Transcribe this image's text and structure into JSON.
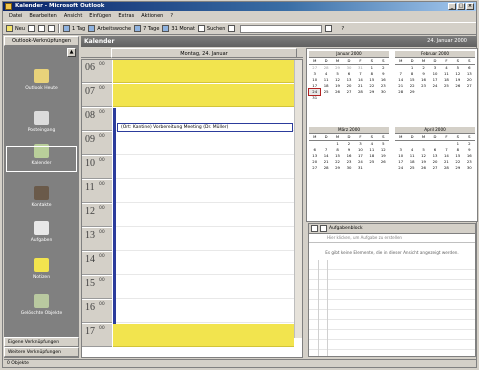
{
  "window": {
    "title": "Kalender - Microsoft Outlook"
  },
  "menu": [
    "Datei",
    "Bearbeiten",
    "Ansicht",
    "Einfügen",
    "Extras",
    "Aktionen",
    "?"
  ],
  "toolbar": {
    "new_label": "Neu",
    "btn1": "1 Tag",
    "btn2": "Arbeitswoche",
    "btn3": "7 Tage",
    "btn4": "31 Monat",
    "btn5": "Suchen",
    "help": "?"
  },
  "sidebar": {
    "header": "Outlook-Verknüpfungen",
    "items": [
      {
        "label": "Outlook Heute"
      },
      {
        "label": "Posteingang"
      },
      {
        "label": "Kalender"
      },
      {
        "label": "Kontakte"
      },
      {
        "label": "Aufgaben"
      },
      {
        "label": "Notizen"
      },
      {
        "label": "Gelöschte Objekte"
      }
    ],
    "group2": "Eigene Verknüpfungen",
    "group3": "Weitere Verknüpfungen"
  },
  "calendar": {
    "folder": "Kalender",
    "date_range": "24. Januar 2000",
    "day_label": "Montag, 24. Januar",
    "hours": [
      {
        "h": "06",
        "m": "00"
      },
      {
        "h": "07",
        "m": "00"
      },
      {
        "h": "08",
        "m": "00"
      },
      {
        "h": "09",
        "m": "00"
      },
      {
        "h": "10",
        "m": "00"
      },
      {
        "h": "11",
        "m": "00"
      },
      {
        "h": "12",
        "m": "00"
      },
      {
        "h": "13",
        "m": "00"
      },
      {
        "h": "14",
        "m": "00"
      },
      {
        "h": "15",
        "m": "00"
      },
      {
        "h": "16",
        "m": "00"
      },
      {
        "h": "17",
        "m": "00"
      }
    ],
    "appointment": "(Ort: Kantine) Vorbereitung Meeting (Dr. Müller)"
  },
  "mini_months": [
    {
      "name": "Januar 2000",
      "weekdays": [
        "M",
        "D",
        "M",
        "D",
        "F",
        "S",
        "S"
      ],
      "days": [
        "27",
        "28",
        "29",
        "30",
        "31",
        "1",
        "2",
        "3",
        "4",
        "5",
        "6",
        "7",
        "8",
        "9",
        "10",
        "11",
        "12",
        "13",
        "14",
        "15",
        "16",
        "17",
        "18",
        "19",
        "20",
        "21",
        "22",
        "23",
        "24",
        "25",
        "26",
        "27",
        "28",
        "29",
        "30",
        "31"
      ]
    },
    {
      "name": "Februar 2000",
      "weekdays": [
        "M",
        "D",
        "M",
        "D",
        "F",
        "S",
        "S"
      ],
      "days": [
        "",
        "1",
        "2",
        "3",
        "4",
        "5",
        "6",
        "7",
        "8",
        "9",
        "10",
        "11",
        "12",
        "13",
        "14",
        "15",
        "16",
        "17",
        "18",
        "19",
        "20",
        "21",
        "22",
        "23",
        "24",
        "25",
        "26",
        "27",
        "28",
        "29"
      ]
    },
    {
      "name": "März 2000",
      "weekdays": [
        "M",
        "D",
        "M",
        "D",
        "F",
        "S",
        "S"
      ],
      "days": [
        "",
        "",
        "1",
        "2",
        "3",
        "4",
        "5",
        "6",
        "7",
        "8",
        "9",
        "10",
        "11",
        "12",
        "13",
        "14",
        "15",
        "16",
        "17",
        "18",
        "19",
        "20",
        "21",
        "22",
        "23",
        "24",
        "25",
        "26",
        "27",
        "28",
        "29",
        "30",
        "31"
      ]
    },
    {
      "name": "April 2000",
      "weekdays": [
        "M",
        "D",
        "M",
        "D",
        "F",
        "S",
        "S"
      ],
      "days": [
        "",
        "",
        "",
        "",
        "",
        "1",
        "2",
        "3",
        "4",
        "5",
        "6",
        "7",
        "8",
        "9",
        "10",
        "11",
        "12",
        "13",
        "14",
        "15",
        "16",
        "17",
        "18",
        "19",
        "20",
        "21",
        "22",
        "23",
        "24",
        "25",
        "26",
        "27",
        "28",
        "29",
        "30"
      ]
    }
  ],
  "taskpad": {
    "header": "Aufgabenblock",
    "new_placeholder": "Hier klicken, um Aufgabe zu erstellen",
    "empty": "Es gibt keine Elemente, die in dieser Ansicht angezeigt werden."
  },
  "status": "0 Objekte"
}
